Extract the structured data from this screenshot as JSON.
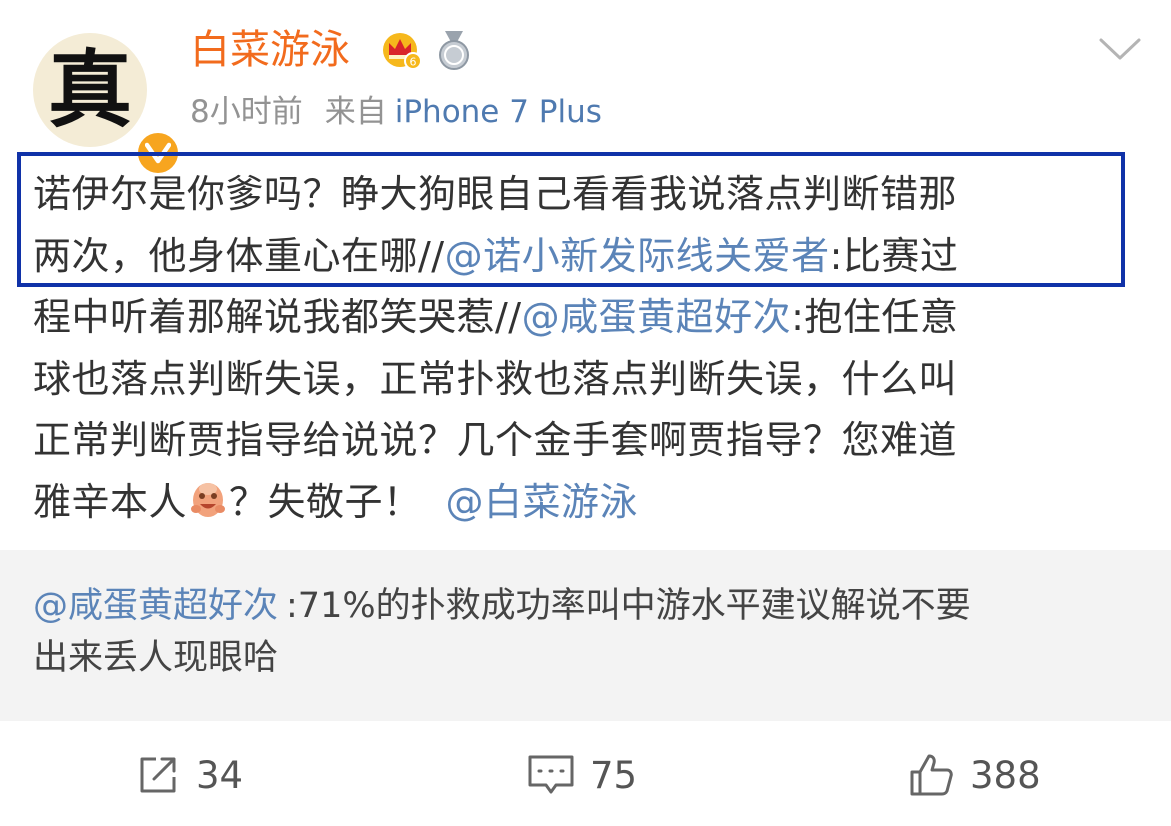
{
  "author": {
    "avatar_glyph": "真",
    "name": "白菜游泳",
    "time": "8小时前",
    "source_prefix": "来自",
    "device": "iPhone 7 Plus"
  },
  "post": {
    "line1": "诺伊尔是你爹吗？睁大狗眼自己看看我说落点判断错那",
    "line2_text": "两次，他身体重心在哪//",
    "line2_mention": "@诺小新发际线关爱者",
    "line2_tail": ":比赛过",
    "line3_text": "程中听着那解说我都笑哭惹//",
    "line3_mention": "@咸蛋黄超好次",
    "line3_tail": ":抱住任意",
    "line4": "球也落点判断失误，正常扑救也落点判断失误，什么叫",
    "line5": "正常判断贾指导给说说？几个金手套啊贾指导？您难道",
    "line6_text": "雅辛本人",
    "line6_after_emoji": "？失敬子！",
    "line6_mention": "@白菜游泳"
  },
  "retweet": {
    "mention": "@咸蛋黄超好次",
    "line1_text": ":71%的扑救成功率叫中游水平建议解说不要",
    "line2_text": "出来丢人现眼哈"
  },
  "actions": {
    "repost_count": "34",
    "comment_count": "75",
    "like_count": "388"
  },
  "colors": {
    "username": "#f26b1d",
    "mention": "#5b84b8",
    "highlight_border": "#1032a8",
    "verified_badge": "#f7a51f"
  },
  "icons": {
    "verified": "verified-v-icon",
    "vip": "crown-vip-icon",
    "medal": "medal-icon",
    "menu": "chevron-down-icon",
    "emoji": "laughing-emoji-icon",
    "repost": "share-icon",
    "comment": "comment-icon",
    "like": "thumbs-up-icon"
  }
}
